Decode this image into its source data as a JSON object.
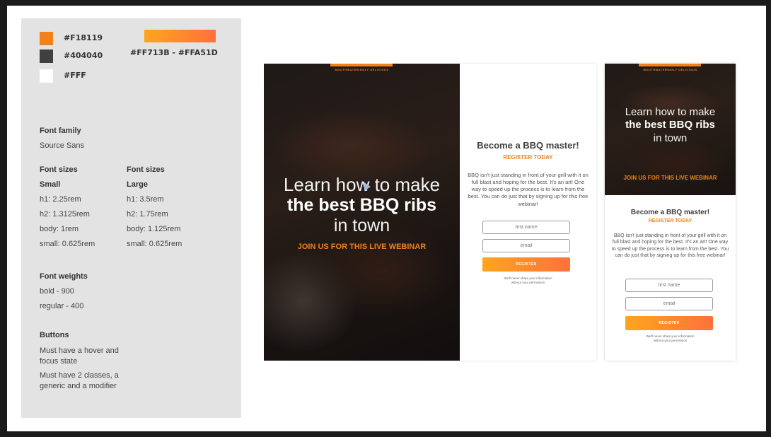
{
  "colors": [
    {
      "hex": "#F18119",
      "label": "#F18119"
    },
    {
      "hex": "#404040",
      "label": "#404040"
    },
    {
      "hex": "#FFFFFF",
      "label": "#FFF"
    }
  ],
  "gradient": {
    "label": "#FF713B - #FFA51D",
    "from": "#FFA51D",
    "to": "#FF713B"
  },
  "font_family": {
    "heading": "Font family",
    "value": "Source Sans"
  },
  "font_sizes": {
    "small": {
      "heading": "Font sizes",
      "sub": "Small",
      "h1": "h1: 2.25rem",
      "h2": "h2: 1.3125rem",
      "body": "body: 1rem",
      "small": "small: 0.625rem"
    },
    "large": {
      "heading": "Font sizes",
      "sub": "Large",
      "h1": "h1: 3.5rem",
      "h2": "h2: 1.75rem",
      "body": "body: 1.125rem",
      "small": "small: 0.625rem"
    }
  },
  "font_weights": {
    "heading": "Font weights",
    "bold": "bold - 900",
    "regular": "regular - 400"
  },
  "buttons": {
    "heading": "Buttons",
    "rule1": "Must have a hover and focus state",
    "rule2": "Must have 2 classes, a generic and a modifier"
  },
  "mockup": {
    "tagline": "MOUTHWATERINGLY DELICIOUS",
    "hero_line1": "Learn how to make",
    "hero_line2": "the best BBQ ribs",
    "hero_line3": "in town",
    "hero_cta": "JOIN US FOR THIS LIVE WEBINAR",
    "form_title": "Become a BBQ master!",
    "form_subtitle": "REGISTER TODAY",
    "form_body": "BBQ isn't just standing in front of your grill with it on full blast and hoping for the best. It's an art! One way to speed up the process is to learn from the best. You can do just that by signing up for this free webinar!",
    "placeholder_name": "first name",
    "placeholder_email": "email",
    "button_label": "REGISTER",
    "note_line1": "We'll never share your information",
    "note_line2": "without your permission"
  }
}
